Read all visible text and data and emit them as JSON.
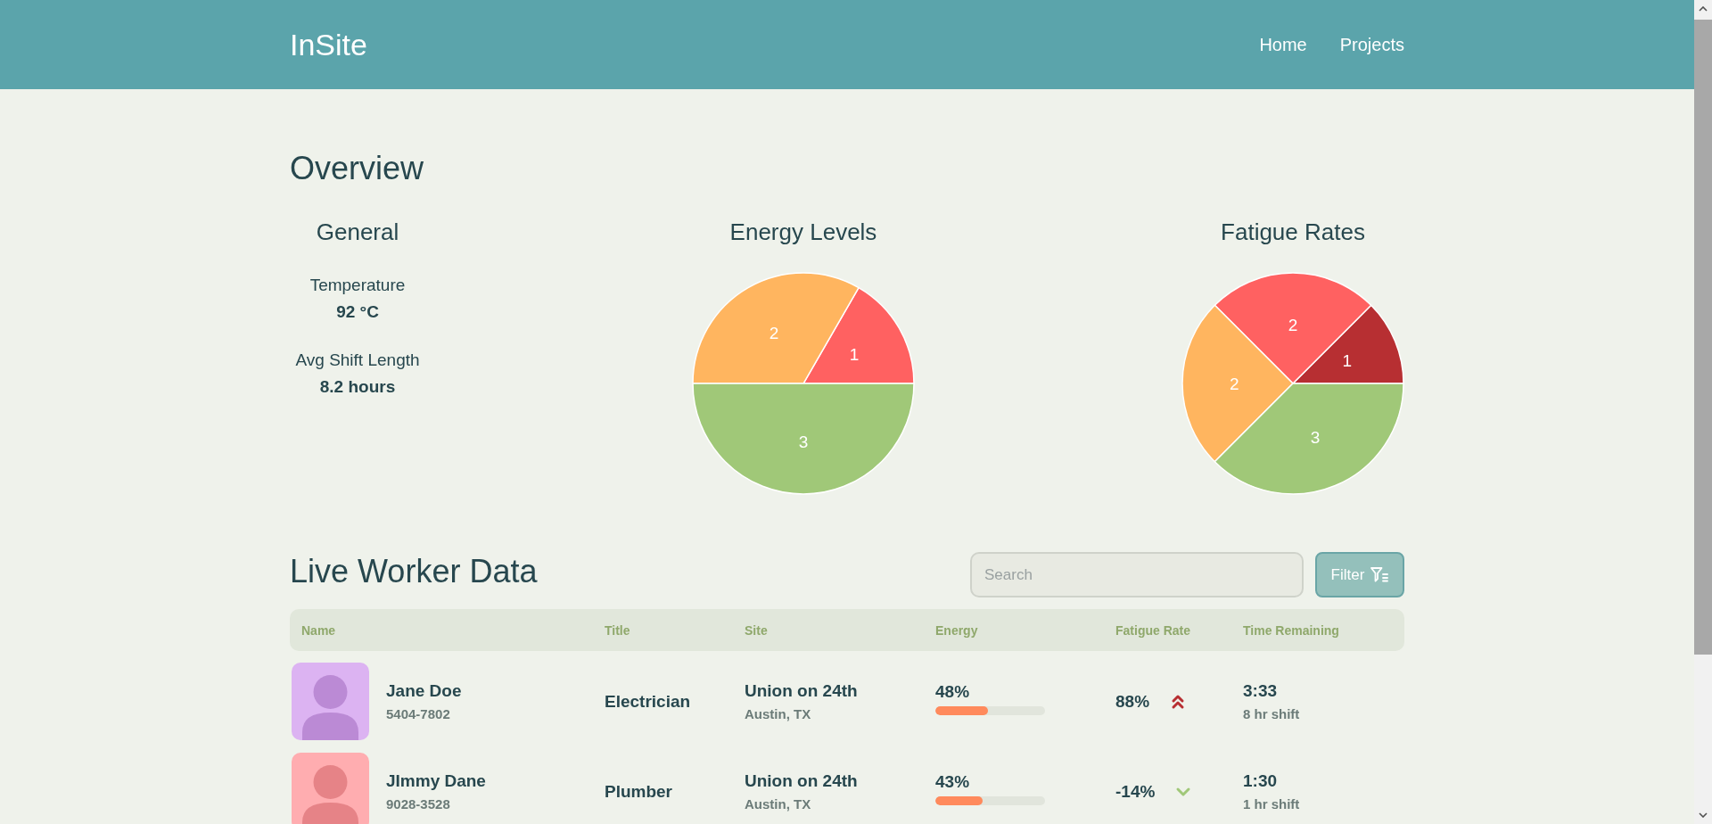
{
  "header": {
    "logo": "InSite",
    "nav": [
      {
        "label": "Home"
      },
      {
        "label": "Projects"
      }
    ]
  },
  "overview": {
    "title": "Overview",
    "general": {
      "title": "General",
      "stats": [
        {
          "label": "Temperature",
          "value": "92 °C"
        },
        {
          "label": "Avg Shift Length",
          "value": "8.2 hours"
        }
      ]
    },
    "charts": [
      {
        "chart_data": {
          "type": "pie",
          "title": "Energy Levels",
          "values": [
            1,
            2,
            3
          ],
          "colors": [
            "#ff6161",
            "#ffb55f",
            "#a0c878"
          ],
          "data_labels": true
        }
      },
      {
        "chart_data": {
          "type": "pie",
          "title": "Fatigue Rates",
          "values": [
            1,
            2,
            2,
            3
          ],
          "colors": [
            "#b72f32",
            "#ff6161",
            "#ffb55f",
            "#a0c878"
          ],
          "data_labels": true
        }
      }
    ]
  },
  "workers": {
    "title": "Live Worker Data",
    "search": {
      "placeholder": "Search"
    },
    "filter_button": {
      "label": "Filter"
    },
    "columns": [
      "Name",
      "Title",
      "Site",
      "Energy",
      "Fatigue Rate",
      "Time Remaining"
    ],
    "rows": [
      {
        "name": "Jane Doe",
        "phone": "5404-7802",
        "color": "#dcb3f2",
        "title": "Electrician",
        "site": "Union on 24th",
        "location": "Austin, TX",
        "energy": {
          "reading": "48%",
          "level": 0.48
        },
        "fatigue": {
          "reading": "88%",
          "rising": true
        },
        "time_remaining": "3:33",
        "shift": "8 hr shift"
      },
      {
        "name": "JImmy Dane",
        "phone": "9028-3528",
        "color": "#ffadb0",
        "title": "Plumber",
        "site": "Union on 24th",
        "location": "Austin, TX",
        "energy": {
          "reading": "43%",
          "level": 0.43
        },
        "fatigue": {
          "reading": "-14%",
          "rising": false
        },
        "time_remaining": "1:30",
        "shift": "1 hr shift"
      }
    ]
  }
}
